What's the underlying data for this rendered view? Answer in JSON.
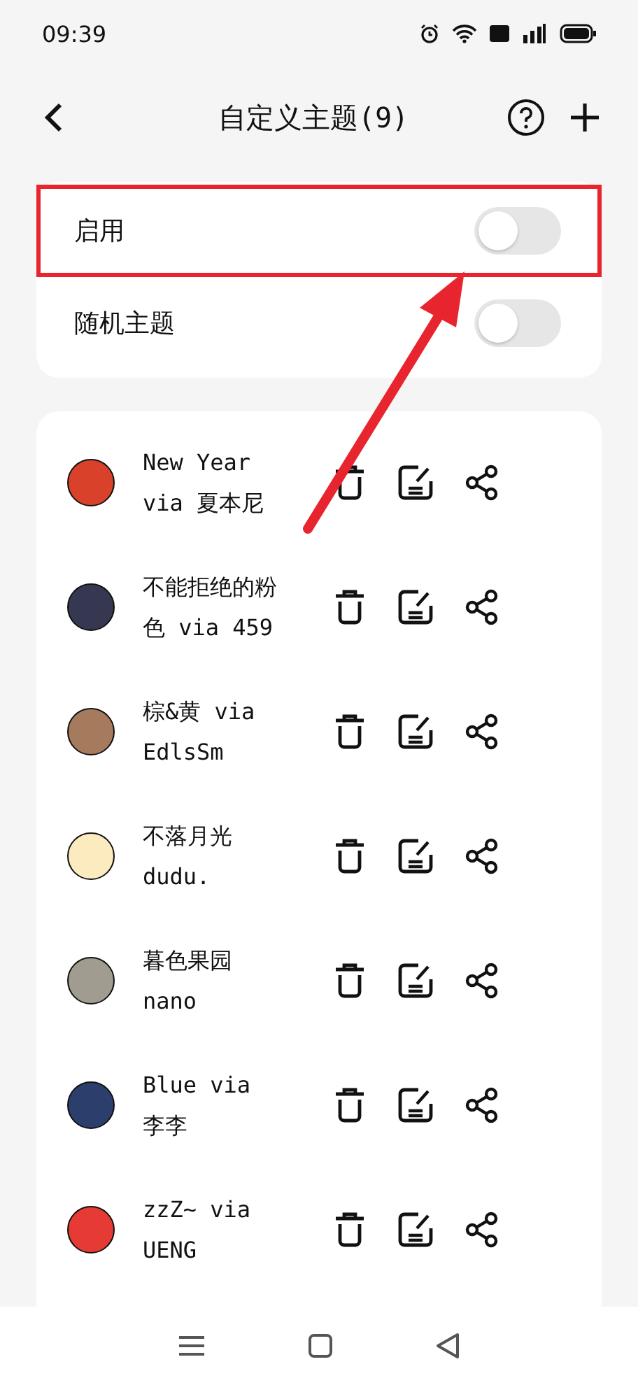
{
  "status_bar": {
    "time": "09:39"
  },
  "header": {
    "title": "自定义主题(9)"
  },
  "settings": [
    {
      "label": "启用",
      "on": false,
      "highlighted": true
    },
    {
      "label": "随机主题",
      "on": false,
      "highlighted": false
    }
  ],
  "themes": [
    {
      "name": "New Year via 夏本尼",
      "color": "#d9412a"
    },
    {
      "name": "不能拒绝的粉色 via 459",
      "color": "#363852"
    },
    {
      "name": "棕&黄 via EdlsSm",
      "color": "#a57a5d"
    },
    {
      "name": "不落月光 dudu.",
      "color": "#fdebc0"
    },
    {
      "name": "暮色果园 nano",
      "color": "#a09d90"
    },
    {
      "name": "Blue via 李李",
      "color": "#2c3f6c"
    },
    {
      "name": "zzZ~ via UENG",
      "color": "#e63b35"
    }
  ]
}
